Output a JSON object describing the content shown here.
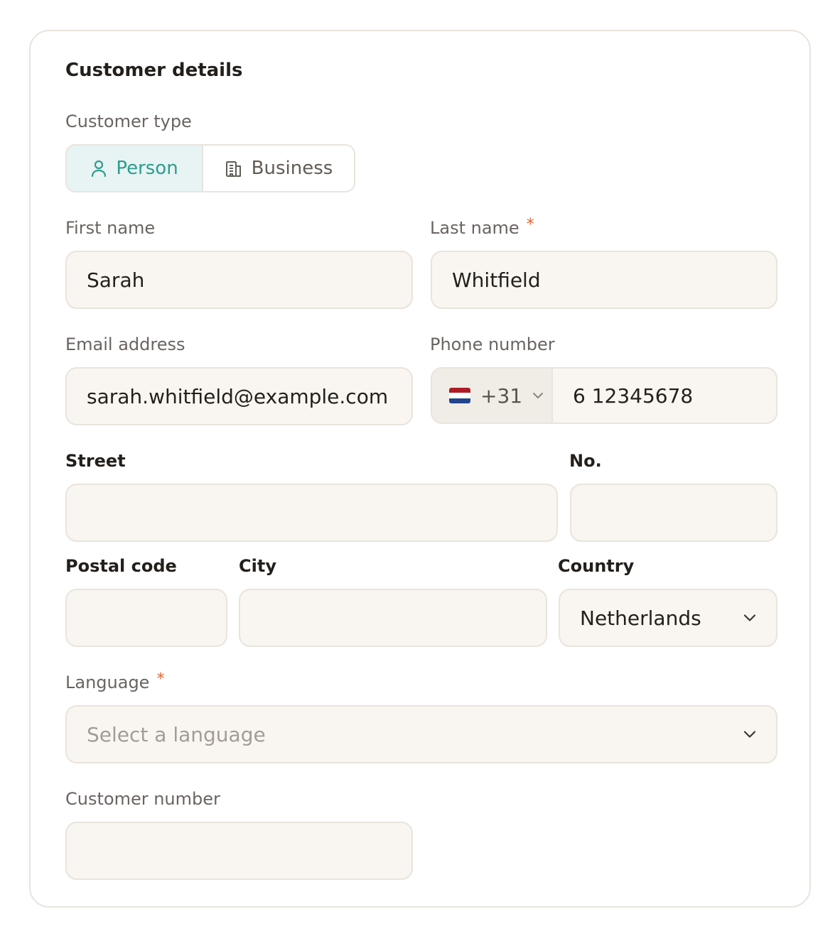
{
  "form": {
    "title": "Customer details",
    "customer_type": {
      "label": "Customer type",
      "options": [
        {
          "label": "Person",
          "icon": "person-icon",
          "selected": true
        },
        {
          "label": "Business",
          "icon": "building-icon",
          "selected": false
        }
      ]
    },
    "first_name": {
      "label": "First name",
      "value": "Sarah"
    },
    "last_name": {
      "label": "Last name",
      "required_mark": "*",
      "value": "Whitfield"
    },
    "email": {
      "label": "Email address",
      "value": "sarah.whitfield@example.com"
    },
    "phone": {
      "label": "Phone number",
      "country_code": "+31",
      "flag": "netherlands-flag-icon",
      "value": "6 12345678"
    },
    "street": {
      "label": "Street",
      "value": ""
    },
    "number": {
      "label": "No.",
      "value": ""
    },
    "postal_code": {
      "label": "Postal code",
      "value": ""
    },
    "city": {
      "label": "City",
      "value": ""
    },
    "country": {
      "label": "Country",
      "value": "Netherlands"
    },
    "language": {
      "label": "Language",
      "required_mark": "*",
      "placeholder": "Select a language"
    },
    "customer_number": {
      "label": "Customer number",
      "value": ""
    }
  },
  "colors": {
    "accent": "#2e9c8f",
    "accent_bg": "#e7f4f3",
    "required": "#e0663a",
    "field_bg": "#f9f6f1",
    "border": "#e9e4dc"
  }
}
